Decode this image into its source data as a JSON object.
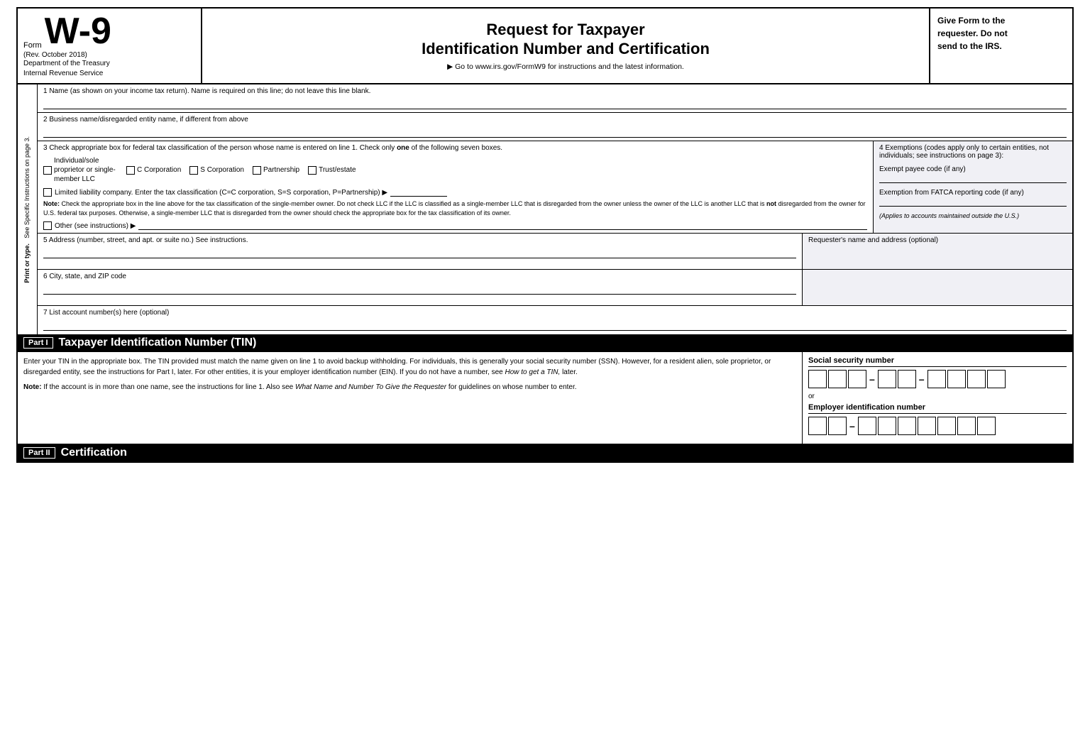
{
  "header": {
    "form_word": "Form",
    "form_number": "W-9",
    "rev_date": "(Rev. October 2018)",
    "dept_line1": "Department of the Treasury",
    "dept_line2": "Internal Revenue Service",
    "title_line1": "Request for Taxpayer",
    "title_line2": "Identification Number and Certification",
    "subtitle": "▶ Go to www.irs.gov/FormW9 for instructions and the latest information.",
    "right_text_line1": "Give Form to the",
    "right_text_line2": "requester. Do not",
    "right_text_line3": "send to the IRS."
  },
  "sidebar": {
    "text1": "Print or type.",
    "text2": "See Specific Instructions on page 3."
  },
  "fields": {
    "field1_label": "1  Name (as shown on your income tax return). Name is required on this line; do not leave this line blank.",
    "field2_label": "2  Business name/disregarded entity name, if different from above",
    "field3_label": "3  Check appropriate box for federal tax classification of the person whose name is entered on line 1. Check only ",
    "field3_label_bold": "one",
    "field3_label_end": " of the following seven boxes.",
    "checkbox_individual": "Individual/sole proprietor or\nsingle-member LLC",
    "checkbox_c_corp": "C Corporation",
    "checkbox_s_corp": "S Corporation",
    "checkbox_partnership": "Partnership",
    "checkbox_trust": "Trust/estate",
    "llc_label": "Limited liability company. Enter the tax classification (C=C corporation, S=S corporation, P=Partnership) ▶",
    "note_label": "Note:",
    "note_text": " Check the appropriate box in the line above for the tax classification of the single-member owner. Do not check LLC if the LLC is classified as a single-member LLC that is disregarded from the owner unless the owner of the LLC is another LLC that is ",
    "note_bold": "not",
    "note_text2": " disregarded from the owner for U.S. federal tax purposes. Otherwise, a single-member LLC that is disregarded from the owner should check the appropriate box for the tax classification of its owner.",
    "other_label": "Other (see instructions) ▶",
    "field4_title": "4  Exemptions (codes apply only to certain entities, not individuals; see instructions on page 3):",
    "exempt_payee_label": "Exempt payee code (if any)",
    "fatca_label": "Exemption from FATCA reporting code (if any)",
    "fatca_italic": "(Applies to accounts maintained outside the U.S.)",
    "field5_label": "5  Address (number, street, and apt. or suite no.) See instructions.",
    "requester_label": "Requester's name and address (optional)",
    "field6_label": "6  City, state, and ZIP code",
    "field7_label": "7  List account number(s) here (optional)"
  },
  "part1": {
    "label": "Part I",
    "title": "Taxpayer Identification Number (TIN)",
    "body_text": "Enter your TIN in the appropriate box. The TIN provided must match the name given on line 1 to avoid backup withholding. For individuals, this is generally your social security number (SSN). However, for a resident alien, sole proprietor, or disregarded entity, see the instructions for Part I, later. For other entities, it is your employer identification number (EIN). If you do not have a number, see ",
    "body_italic": "How to get a TIN,",
    "body_text2": " later.",
    "note_prefix": "Note:",
    "note_body": " If the account is in more than one name, see the instructions for line 1. Also see ",
    "note_italic": "What Name and Number To Give the Requester",
    "note_body2": " for guidelines on whose number to enter.",
    "ssn_label": "Social security number",
    "ssn_cells": [
      "",
      "",
      "",
      "-",
      "",
      "",
      "-",
      "",
      "",
      "",
      ""
    ],
    "or_text": "or",
    "ein_label": "Employer identification number",
    "ein_cells": [
      "",
      "",
      "-",
      "",
      "",
      "",
      "",
      "",
      "",
      ""
    ]
  },
  "part2": {
    "label": "Part II",
    "title": "Certification"
  }
}
